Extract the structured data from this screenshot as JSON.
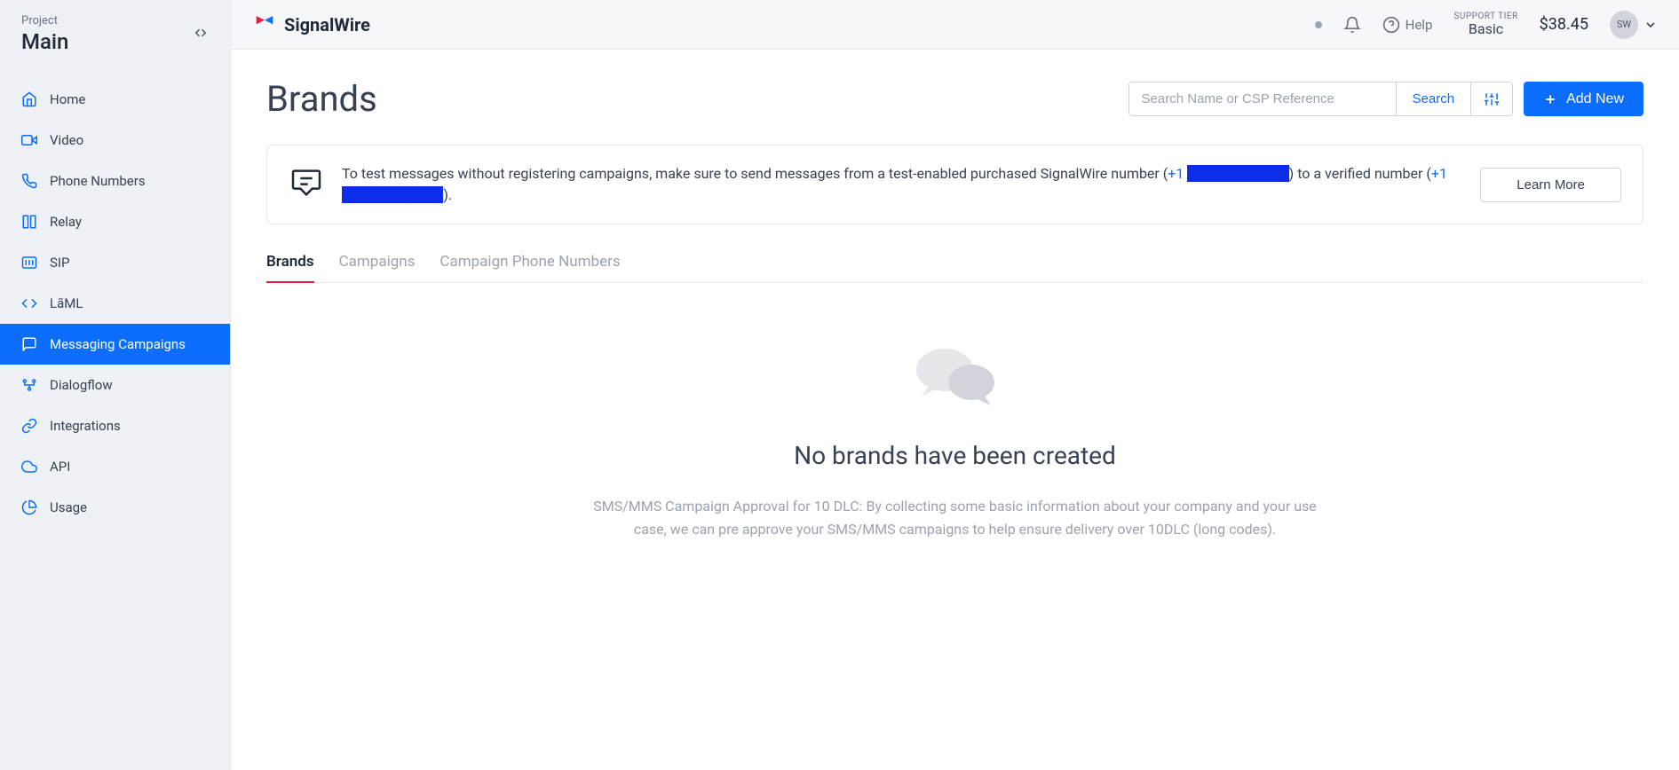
{
  "sidebar": {
    "project_label": "Project",
    "project_name": "Main",
    "items": [
      {
        "icon": "home",
        "label": "Home"
      },
      {
        "icon": "video",
        "label": "Video"
      },
      {
        "icon": "phone",
        "label": "Phone Numbers"
      },
      {
        "icon": "relay",
        "label": "Relay"
      },
      {
        "icon": "sip",
        "label": "SIP"
      },
      {
        "icon": "laml",
        "label": "LāML"
      },
      {
        "icon": "chat",
        "label": "Messaging Campaigns"
      },
      {
        "icon": "dialogflow",
        "label": "Dialogflow"
      },
      {
        "icon": "link",
        "label": "Integrations"
      },
      {
        "icon": "cloud",
        "label": "API"
      },
      {
        "icon": "pie",
        "label": "Usage"
      }
    ]
  },
  "topbar": {
    "brand": "SignalWire",
    "help": "Help",
    "support_tier_label": "SUPPORT TIER",
    "support_tier_value": "Basic",
    "balance": "$38.45",
    "avatar_initials": "SW"
  },
  "page": {
    "title": "Brands",
    "search_placeholder": "Search Name or CSP Reference",
    "search_button": "Search",
    "add_button": "Add New"
  },
  "notice": {
    "text_before": "To test messages without registering campaigns, make sure to send messages from a test-enabled purchased SignalWire number (",
    "link1_prefix": "+1",
    "text_middle": ") to a verified number (",
    "link2_prefix": "+1",
    "text_after": ").",
    "learn_more": "Learn More"
  },
  "tabs": [
    {
      "label": "Brands",
      "active": true
    },
    {
      "label": "Campaigns",
      "active": false
    },
    {
      "label": "Campaign Phone Numbers",
      "active": false
    }
  ],
  "empty": {
    "title": "No brands have been created",
    "description": "SMS/MMS Campaign Approval for 10 DLC: By collecting some basic information about your company and your use case, we can pre approve your SMS/MMS campaigns to help ensure delivery over 10DLC (long codes)."
  }
}
